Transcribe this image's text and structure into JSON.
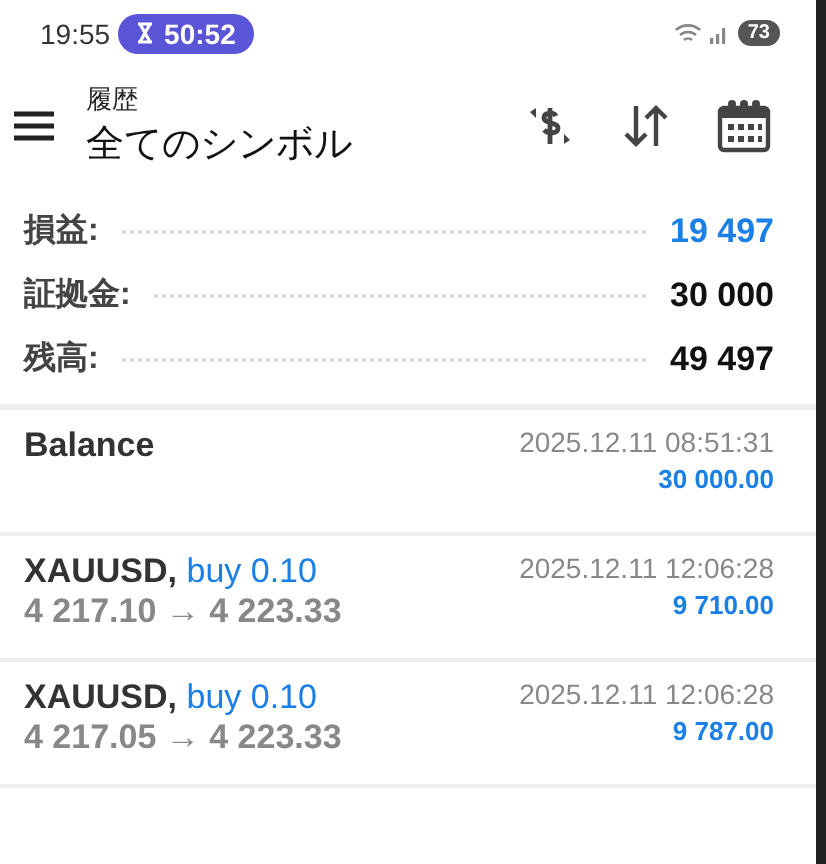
{
  "status_bar": {
    "time": "19:55",
    "timer": "50:52",
    "battery": "73"
  },
  "header": {
    "subtitle": "履歴",
    "title": "全てのシンボル"
  },
  "summary": [
    {
      "label": "損益:",
      "value": "19 497",
      "color": "#1a7fe6"
    },
    {
      "label": "証拠金:",
      "value": "30 000",
      "color": "#111111"
    },
    {
      "label": "残高:",
      "value": "49 497",
      "color": "#111111"
    }
  ],
  "deals": [
    {
      "kind": "balance",
      "title": "Balance",
      "time": "2025.12.11 08:51:31",
      "amount": "30 000.00"
    },
    {
      "kind": "trade",
      "symbol": "XAUUSD,",
      "side": "buy 0.10",
      "prices": "4 217.10 → 4 223.33",
      "time": "2025.12.11 12:06:28",
      "amount": "9 710.00"
    },
    {
      "kind": "trade",
      "symbol": "XAUUSD,",
      "side": "buy 0.10",
      "prices": "4 217.05 → 4 223.33",
      "time": "2025.12.11 12:06:28",
      "amount": "9 787.00"
    }
  ]
}
